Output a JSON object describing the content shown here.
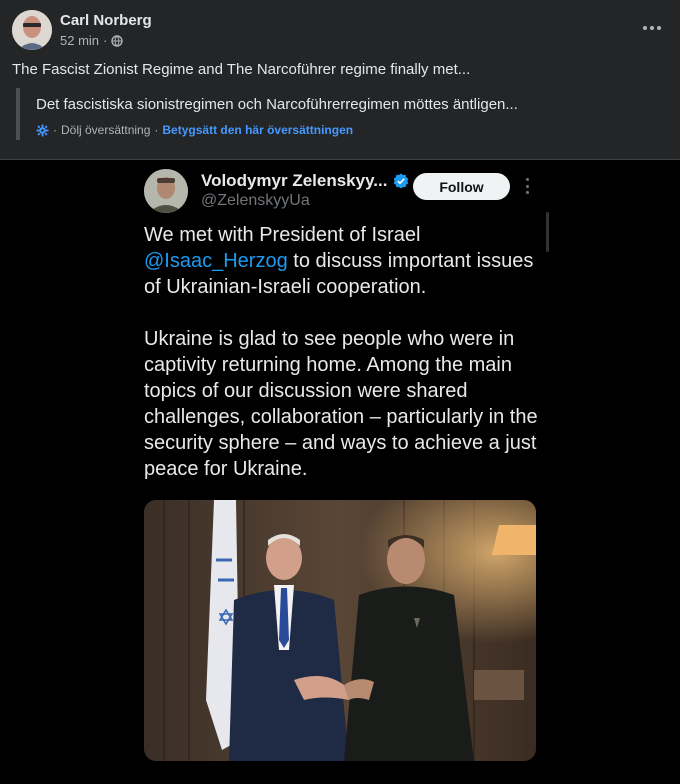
{
  "post": {
    "author": "Carl Norberg",
    "time": "52 min",
    "dot": "·",
    "text": "The Fascist Zionist Regime and The Narcoführer regime finally met...",
    "translation": {
      "text": "Det fascistiska sionistregimen och Narcoführerregimen möttes äntligen...",
      "hide_label": "Dölj översättning",
      "rate_label": "Betygsätt den här översättningen",
      "separator": "·"
    }
  },
  "tweet": {
    "name": "Volodymyr Zelenskyy...",
    "handle": "@ZelenskyyUa",
    "follow_label": "Follow",
    "para1_before": "We met with President of Israel ",
    "mention": "@Isaac_Herzog",
    "para1_after": " to discuss important issues of Ukrainian-Israeli cooperation.",
    "para2": "Ukraine is glad to see people who were in captivity returning home. Among the main topics of our discussion were shared challenges, collaboration – particularly in the security sphere – and ways to achieve a just peace for Ukraine."
  },
  "colors": {
    "card_bg": "#242526",
    "link_blue": "#4599ff",
    "mention_blue": "#1d9bf0",
    "verified_blue": "#1d9bf0"
  },
  "icons": {
    "globe": "globe-icon",
    "gear": "gear-icon",
    "more": "more-options-icon",
    "verified": "verified-badge-icon"
  }
}
